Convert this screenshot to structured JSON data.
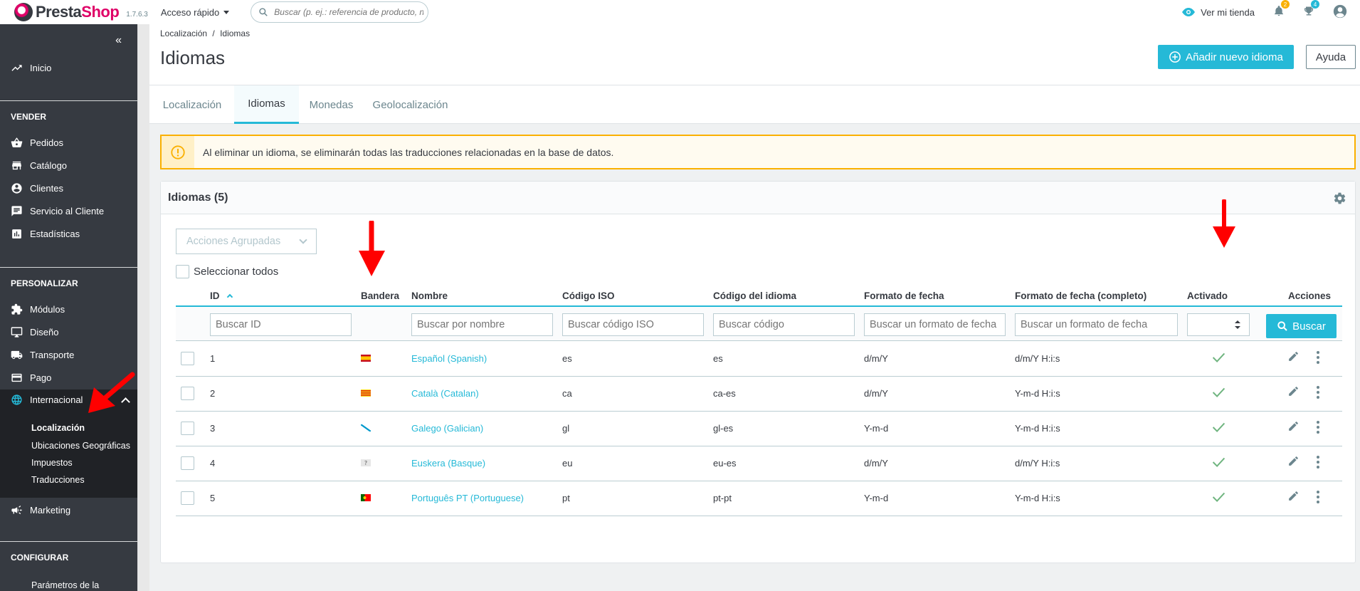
{
  "header": {
    "logo_text_a": "Presta",
    "logo_text_b": "Shop",
    "version": "1.7.6.3",
    "quick_access": "Acceso rápido",
    "search_placeholder": "Buscar (p. ej.: referencia de producto, n",
    "view_shop": "Ver mi tienda",
    "notif_orders": "2",
    "notif_customers": "4"
  },
  "sidebar": {
    "home": "Inicio",
    "sections": {
      "sell": "VENDER",
      "customize": "PERSONALIZAR",
      "configure": "CONFIGURAR"
    },
    "sell_items": [
      "Pedidos",
      "Catálogo",
      "Clientes",
      "Servicio al Cliente",
      "Estadísticas"
    ],
    "customize_items": [
      "Módulos",
      "Diseño",
      "Transporte",
      "Pago",
      "Internacional"
    ],
    "sub_items": [
      "Localización",
      "Ubicaciones Geográficas",
      "Impuestos",
      "Traducciones"
    ],
    "marketing": "Marketing",
    "config_first": "Parámetros de la"
  },
  "breadcrumb": {
    "first": "Localización",
    "sep": "/",
    "current": "Idiomas"
  },
  "page_title": "Idiomas",
  "buttons": {
    "add_language": "Añadir nuevo idioma",
    "help": "Ayuda",
    "search": "Buscar"
  },
  "tabs": [
    "Localización",
    "Idiomas",
    "Monedas",
    "Geolocalización"
  ],
  "alert": "Al eliminar un idioma, se eliminarán todas las traducciones relacionadas en la base de datos.",
  "card": {
    "title": "Idiomas (5)",
    "bulk_actions": "Acciones Agrupadas",
    "select_all": "Seleccionar todos"
  },
  "table": {
    "headers": [
      "ID",
      "Bandera",
      "Nombre",
      "Código ISO",
      "Código del idioma",
      "Formato de fecha",
      "Formato de fecha (completo)",
      "Activado",
      "Acciones"
    ],
    "filters": [
      "Buscar ID",
      "Buscar por nombre",
      "Buscar código ISO",
      "Buscar código",
      "Buscar un formato de fecha",
      "Buscar un formato de fecha"
    ],
    "rows": [
      {
        "id": "1",
        "name": "Español (Spanish)",
        "iso": "es",
        "code": "es",
        "date": "d/m/Y",
        "date_full": "d/m/Y H:i:s",
        "flag": "es"
      },
      {
        "id": "2",
        "name": "Català (Catalan)",
        "iso": "ca",
        "code": "ca-es",
        "date": "d/m/Y",
        "date_full": "Y-m-d H:i:s",
        "flag": "ca"
      },
      {
        "id": "3",
        "name": "Galego (Galician)",
        "iso": "gl",
        "code": "gl-es",
        "date": "Y-m-d",
        "date_full": "Y-m-d H:i:s",
        "flag": "gl"
      },
      {
        "id": "4",
        "name": "Euskera (Basque)",
        "iso": "eu",
        "code": "eu-es",
        "date": "d/m/Y",
        "date_full": "d/m/Y H:i:s",
        "flag": "eu"
      },
      {
        "id": "5",
        "name": "Português PT (Portuguese)",
        "iso": "pt",
        "code": "pt-pt",
        "date": "Y-m-d",
        "date_full": "Y-m-d H:i:s",
        "flag": "pt"
      }
    ]
  },
  "colors": {
    "accent": "#25b9d7",
    "brand": "#df0067",
    "sidebar": "#363a41",
    "warning": "#fab000",
    "success": "#70b580",
    "annotation": "#ff0000"
  }
}
